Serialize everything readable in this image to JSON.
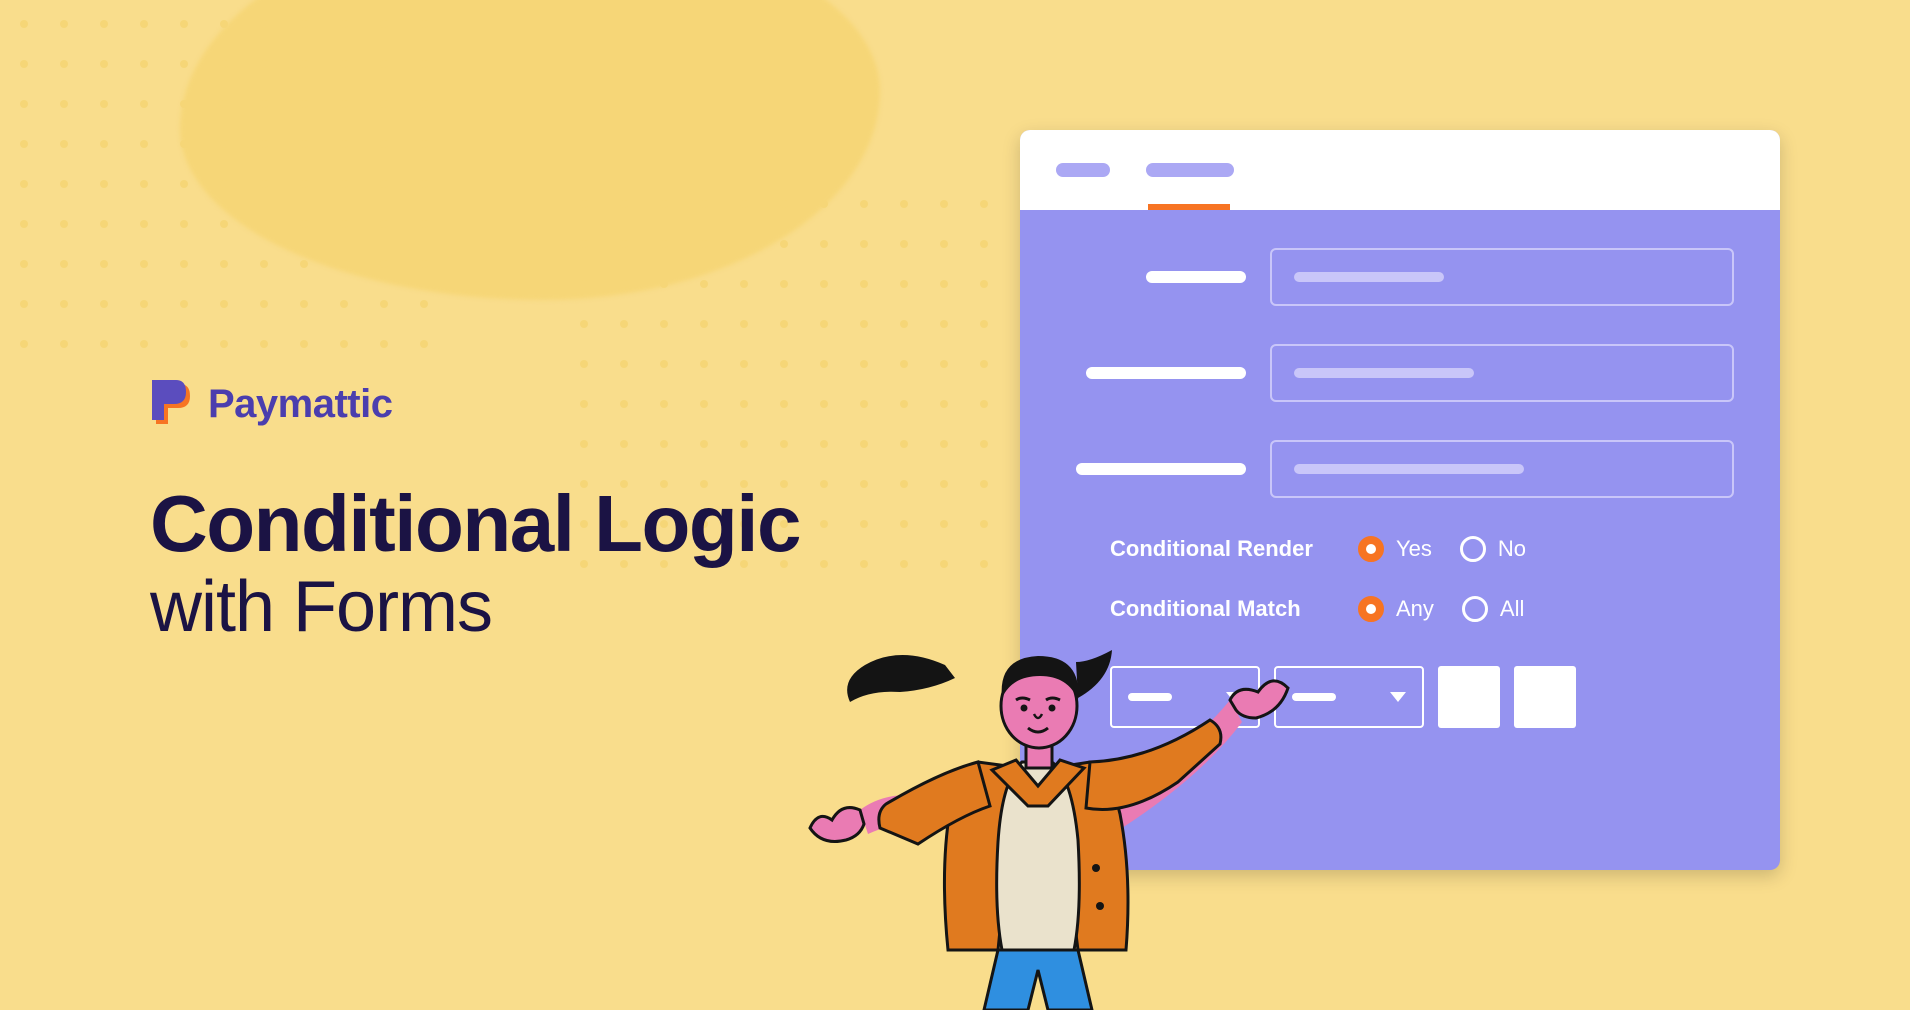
{
  "brand": {
    "name": "Paymattic"
  },
  "headline": {
    "line1": "Conditional Logic",
    "line2": "with Forms"
  },
  "form": {
    "render": {
      "label": "Conditional Render",
      "opts": [
        "Yes",
        "No"
      ],
      "selected": 0
    },
    "match": {
      "label": "Conditional Match",
      "opts": [
        "Any",
        "All"
      ],
      "selected": 0
    }
  }
}
